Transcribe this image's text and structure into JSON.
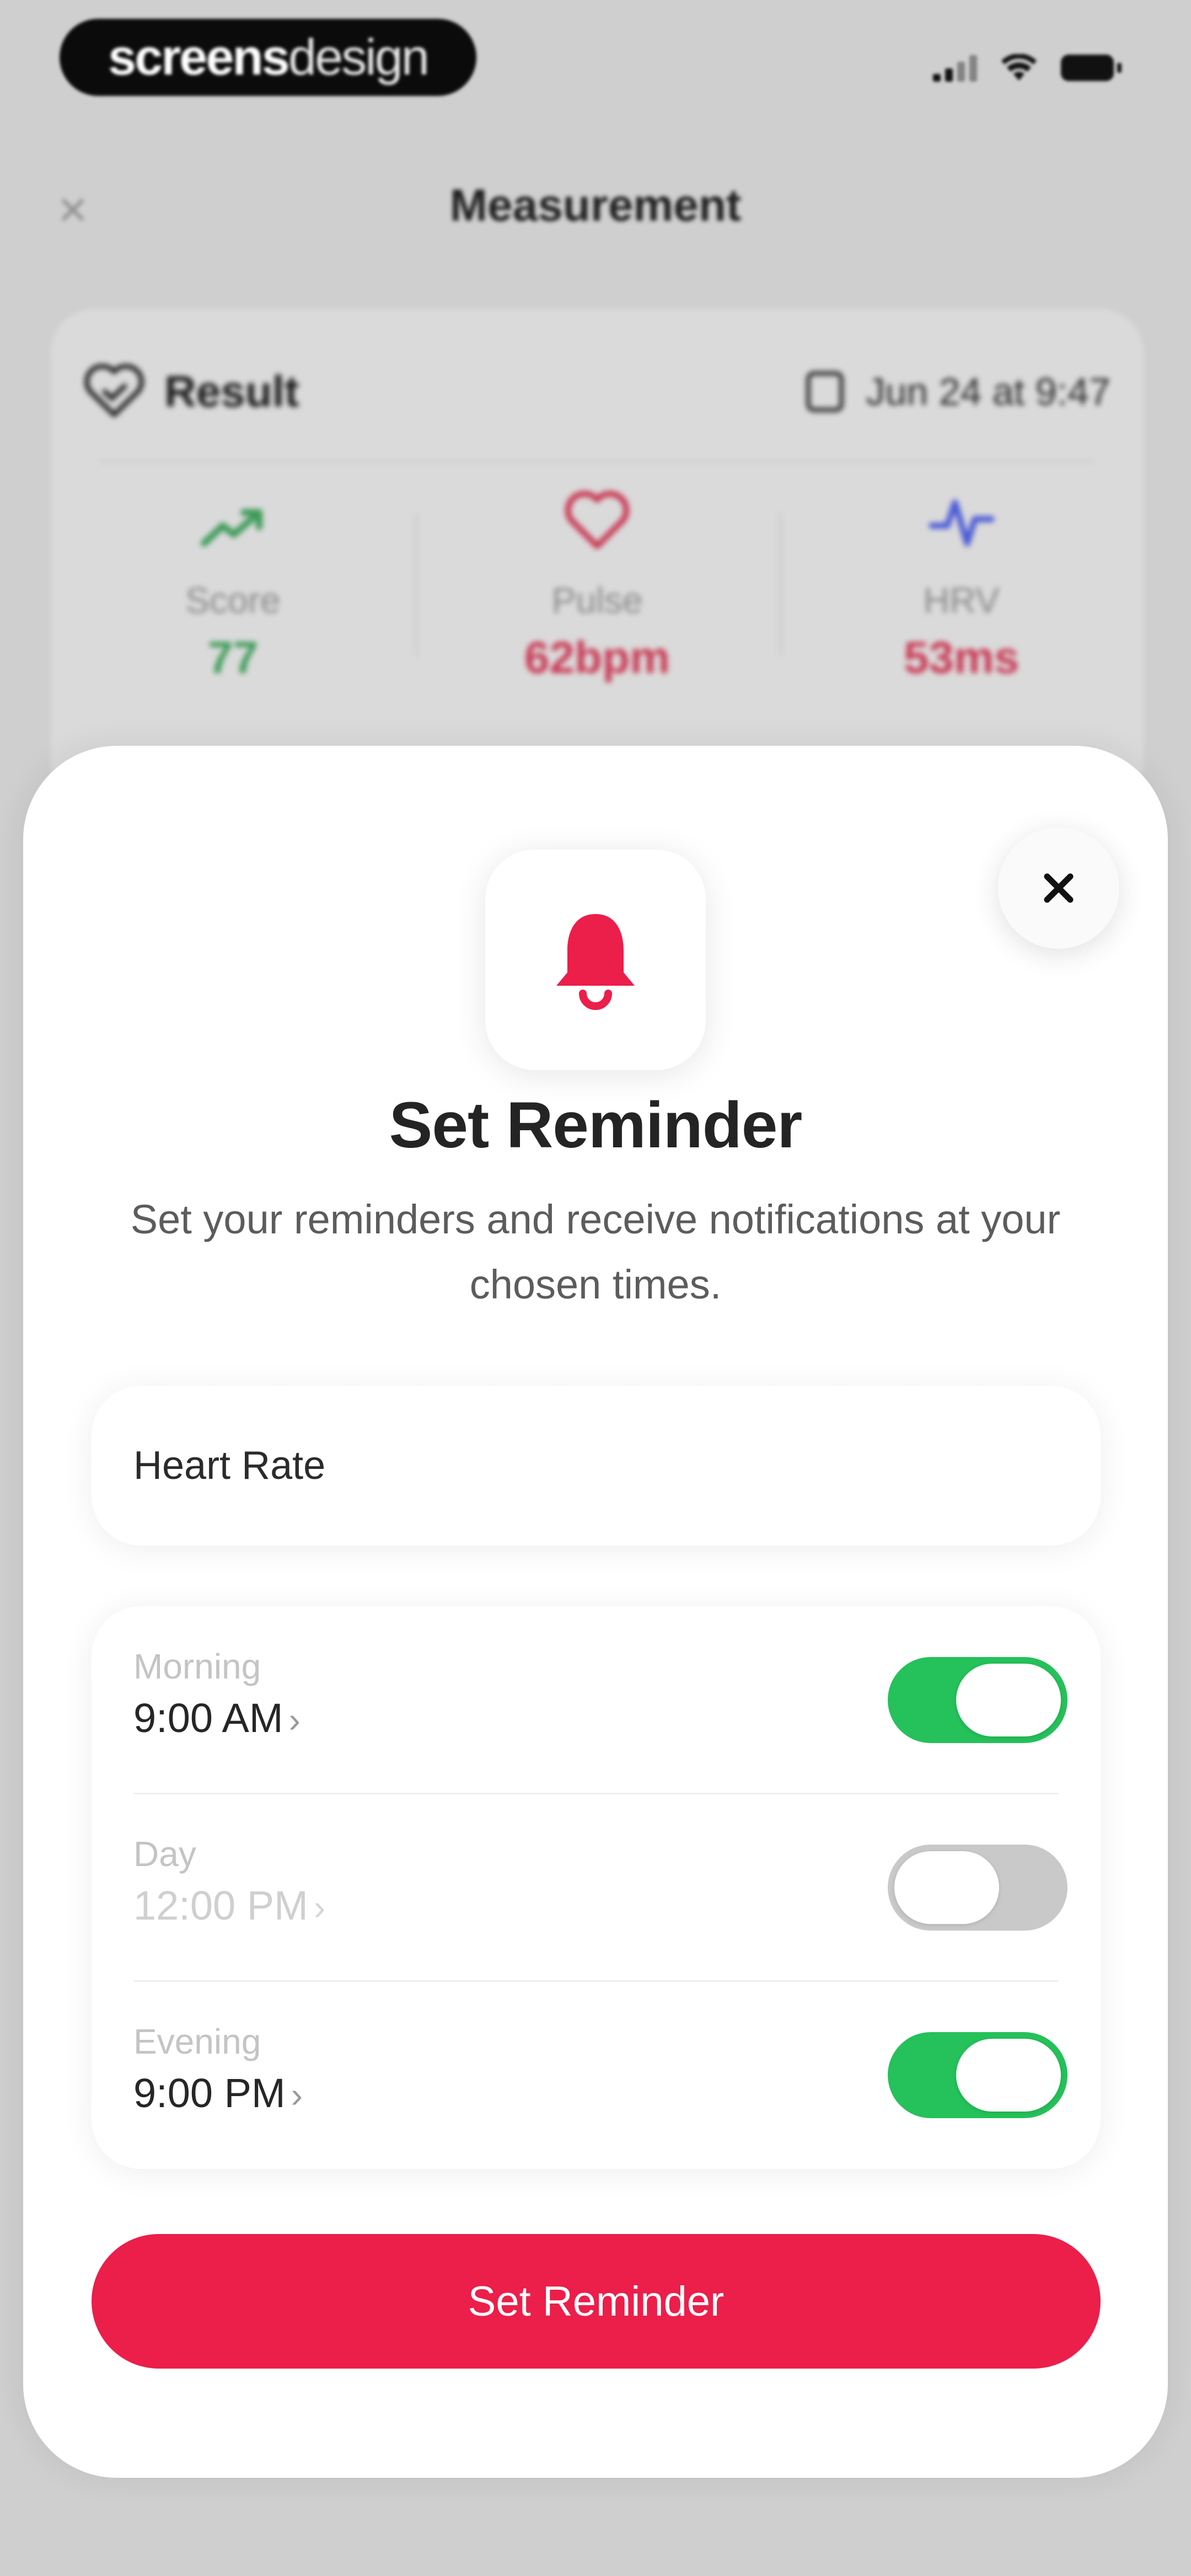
{
  "status_bar": {
    "brand_strong": "screens",
    "brand_light": "design"
  },
  "background": {
    "nav_title": "Measurement",
    "result_title": "Result",
    "result_date": "Jun 24 at 9:47",
    "metrics": [
      {
        "label": "Score",
        "value": "77",
        "color": "#3c9a57",
        "icon": "trend-up-icon"
      },
      {
        "label": "Pulse",
        "value": "62bpm",
        "color": "#c93a55",
        "icon": "heart-icon"
      },
      {
        "label": "HRV",
        "value": "53ms",
        "color": "#c93a55",
        "icon": "pulse-wave-icon"
      }
    ]
  },
  "sheet": {
    "title": "Set Reminder",
    "subtitle": "Set your reminders and receive notifications at your chosen times.",
    "name_value": "Heart Rate",
    "times": [
      {
        "label": "Morning",
        "time": "9:00 AM",
        "enabled": true
      },
      {
        "label": "Day",
        "time": "12:00 PM",
        "enabled": false
      },
      {
        "label": "Evening",
        "time": "9:00 PM",
        "enabled": true
      }
    ],
    "cta_label": "Set Reminder"
  },
  "colors": {
    "accent": "#ec1e4a",
    "toggle_on": "#25c15a",
    "toggle_off": "#c9c9c9"
  }
}
